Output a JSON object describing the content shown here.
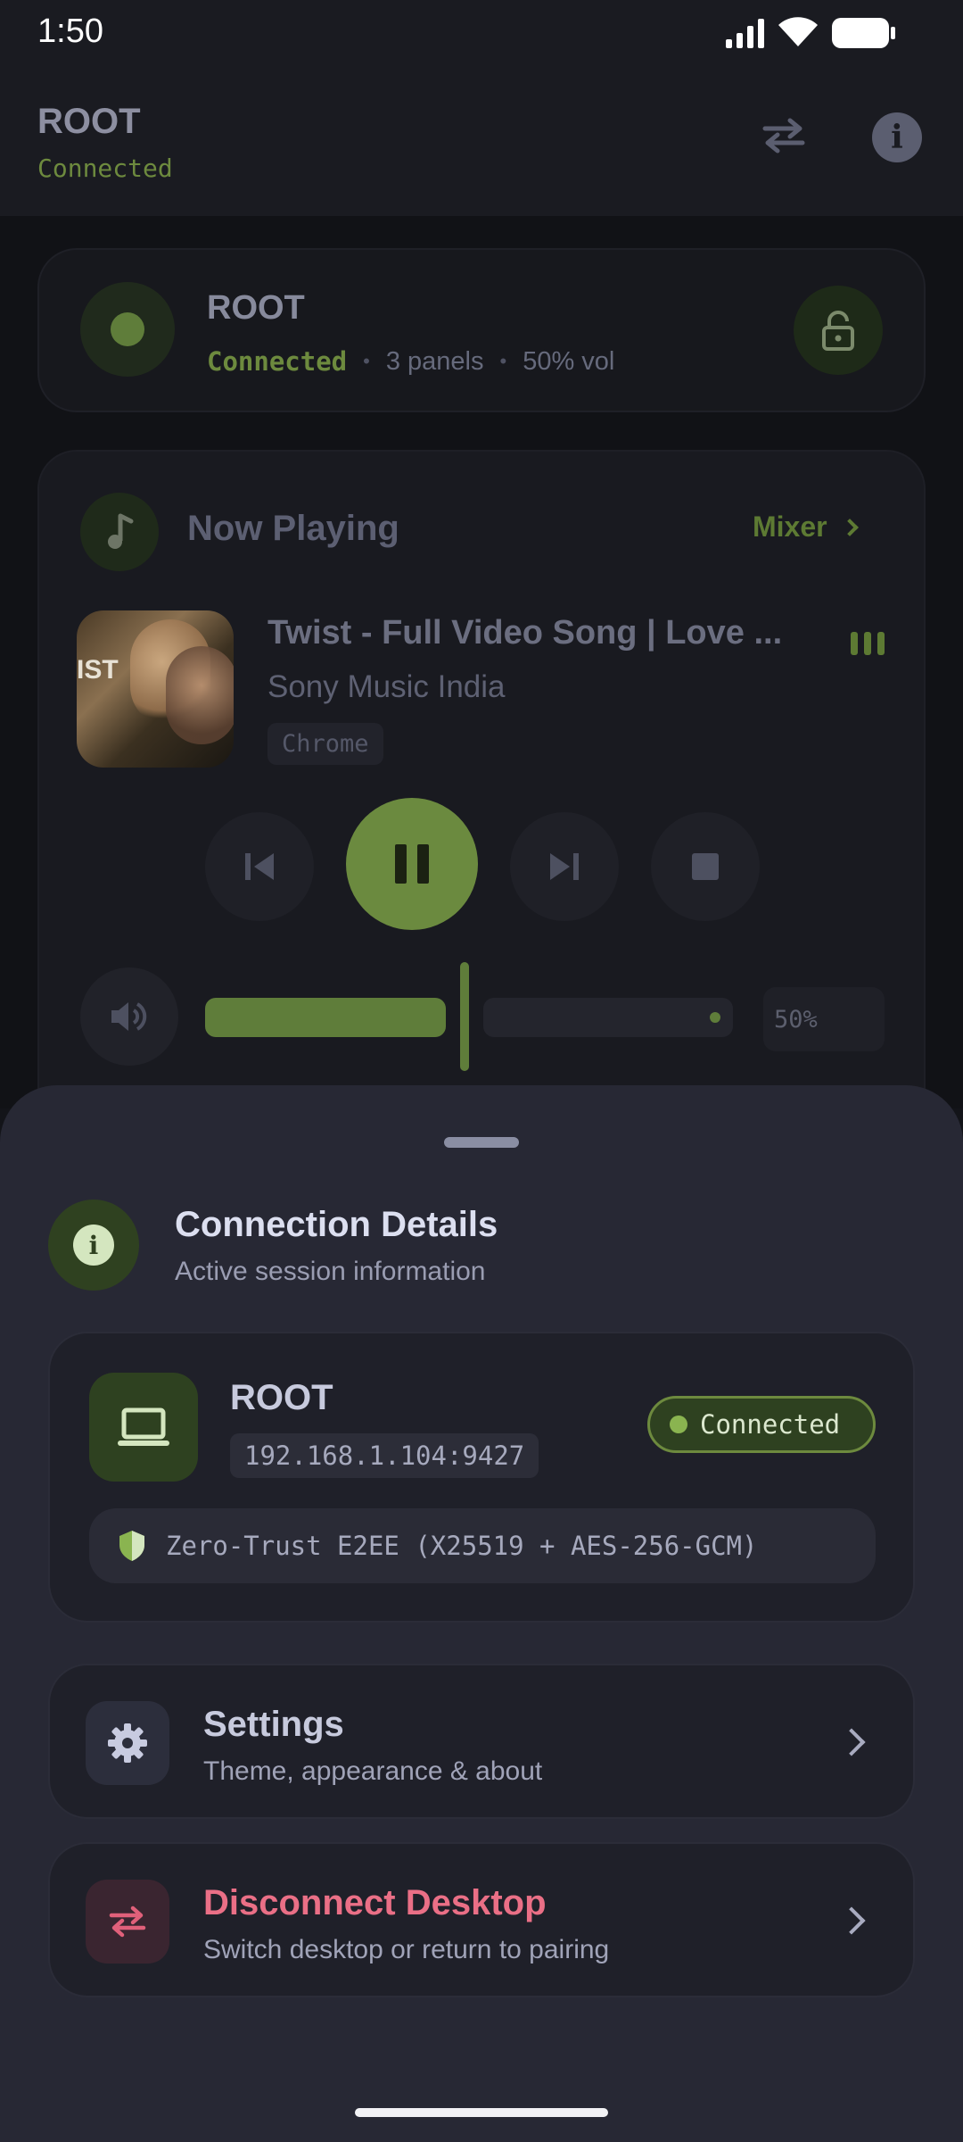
{
  "status": {
    "time": "1:50"
  },
  "header": {
    "title": "ROOT",
    "status": "Connected",
    "icons": [
      "swap-icon",
      "info-icon"
    ]
  },
  "device": {
    "name": "ROOT",
    "status": "Connected",
    "sep1": "•",
    "panels": "3 panels",
    "sep2": "•",
    "volume": "50% vol",
    "icons": [
      "status-dot-icon",
      "lock-icon"
    ]
  },
  "now_playing": {
    "heading": "Now Playing",
    "mixer_label": "Mixer",
    "track_title": "Twist - Full Video Song | Love ...",
    "artist": "Sony Music India",
    "source": "Chrome",
    "album_art_text": "IST",
    "volume_label": "50%",
    "volume_level": 0.5,
    "icons": [
      "music-note-icon",
      "chevron-right-icon",
      "equalizer-icon",
      "skip-previous-icon",
      "pause-icon",
      "skip-next-icon",
      "stop-icon",
      "volume-icon"
    ]
  },
  "sheet": {
    "title": "Connection Details",
    "subtitle": "Active session information",
    "host": {
      "name": "ROOT",
      "address": "192.168.1.104:9427",
      "badge": "Connected",
      "security": "Zero-Trust E2EE (X25519 + AES-256-GCM)"
    },
    "settings": {
      "title": "Settings",
      "subtitle": "Theme, appearance & about"
    },
    "disconnect": {
      "title": "Disconnect Desktop",
      "subtitle": "Switch desktop or return to pairing"
    }
  },
  "colors": {
    "accent_green": "#7a9a4a",
    "text_green": "#6d8a3e",
    "danger": "#e0607a",
    "sheet_bg": "#272834"
  }
}
